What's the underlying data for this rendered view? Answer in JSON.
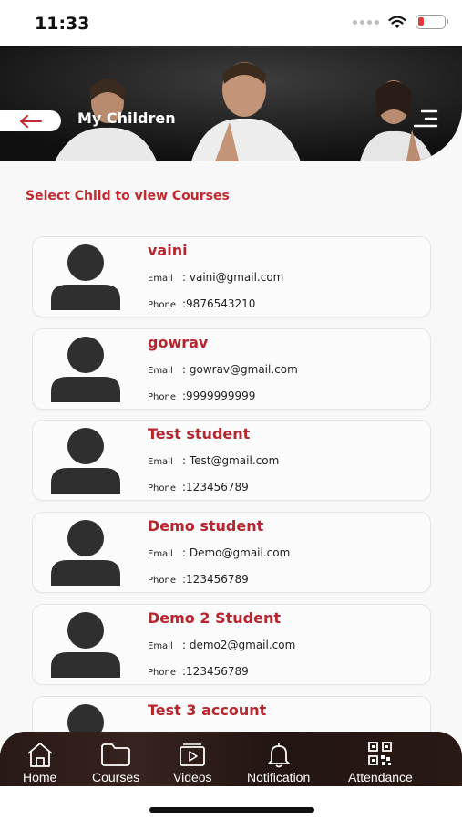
{
  "status_bar": {
    "time": "11:33"
  },
  "header": {
    "title": "My Children"
  },
  "section_title": "Select Child to view Courses",
  "children": [
    {
      "name": "vaini",
      "email_label": "Email",
      "email": ":  vaini@gmail.com",
      "phone_label": "Phone",
      "phone": ":9876543210"
    },
    {
      "name": "gowrav",
      "email_label": "Email",
      "email": ":  gowrav@gmail.com",
      "phone_label": "Phone",
      "phone": ":9999999999"
    },
    {
      "name": "Test student",
      "email_label": "Email",
      "email": ":  Test@gmail.com",
      "phone_label": "Phone",
      "phone": ":123456789"
    },
    {
      "name": "Demo student",
      "email_label": "Email",
      "email": ":  Demo@gmail.com",
      "phone_label": "Phone",
      "phone": ":123456789"
    },
    {
      "name": "Demo 2 Student",
      "email_label": "Email",
      "email": ":  demo2@gmail.com",
      "phone_label": "Phone",
      "phone": ":123456789"
    },
    {
      "name": "Test 3 account",
      "email_label": "",
      "email": "",
      "phone_label": "",
      "phone": ""
    }
  ],
  "tabs": [
    {
      "label": "Home",
      "icon": "home-icon"
    },
    {
      "label": "Courses",
      "icon": "folder-icon"
    },
    {
      "label": "Videos",
      "icon": "video-icon"
    },
    {
      "label": "Notification",
      "icon": "bell-icon"
    },
    {
      "label": "Attendance",
      "icon": "qr-code-icon"
    }
  ],
  "colors": {
    "accent": "#c0292f",
    "name": "#b5262e",
    "tabbar": "#1c1210",
    "header": "#171717"
  }
}
